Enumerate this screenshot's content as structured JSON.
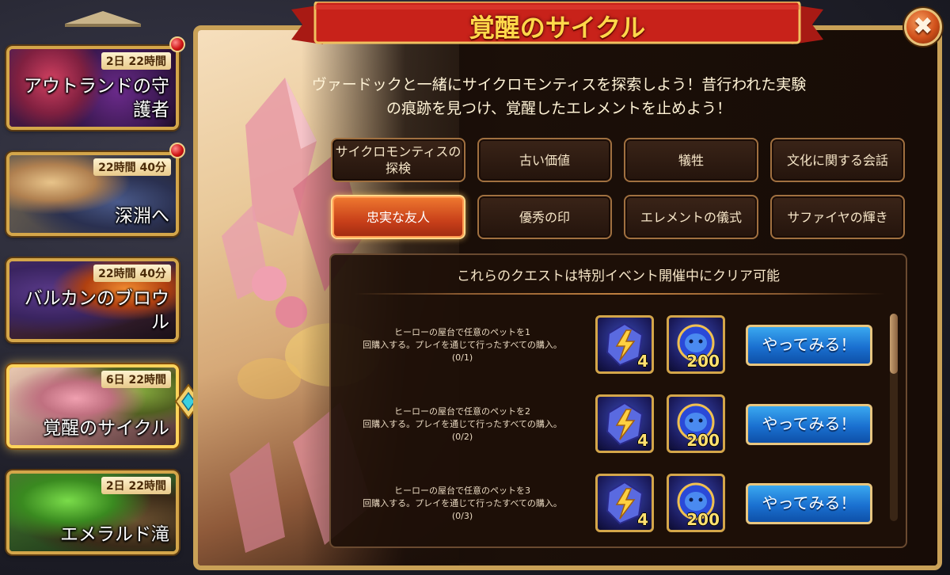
{
  "event_list": [
    {
      "title": "アウトランドの守護者",
      "timer": "2日 22時間",
      "notification": true,
      "active": false
    },
    {
      "title": "深淵へ",
      "timer": "22時間 40分",
      "notification": true,
      "active": false
    },
    {
      "title": "バルカンのブロウル",
      "timer": "22時間 40分",
      "notification": false,
      "active": false
    },
    {
      "title": "覚醒のサイクル",
      "timer": "6日 22時間",
      "notification": false,
      "active": true
    },
    {
      "title": "エメラルド滝",
      "timer": "2日 22時間",
      "notification": false,
      "active": false
    }
  ],
  "panel": {
    "title": "覚醒のサイクル",
    "close_icon": "✖",
    "description": "ヴァードックと一緒にサイクロモンティスを探索しよう！昔行われた実験の痕跡を見つけ、覚醒したエレメントを止めよう！"
  },
  "tabs": [
    {
      "label": "サイクロモンティスの探検",
      "active": false
    },
    {
      "label": "古い価値",
      "active": false
    },
    {
      "label": "犠牲",
      "active": false
    },
    {
      "label": "文化に関する会話",
      "active": false
    },
    {
      "label": "忠実な友人",
      "active": true
    },
    {
      "label": "優秀の印",
      "active": false
    },
    {
      "label": "エレメントの儀式",
      "active": false
    },
    {
      "label": "サファイヤの輝き",
      "active": false
    }
  ],
  "quests": {
    "header": "これらのクエストは特別イベント開催中にクリア可能",
    "items": [
      {
        "line1": "ヒーローの屋台で任意のペットを1",
        "line2": "回購入する。プレイを通じて行ったすべての購入。",
        "progress": "(0/1)",
        "reward1_qty": "4",
        "reward2_qty": "200",
        "button": "やってみる！"
      },
      {
        "line1": "ヒーローの屋台で任意のペットを2",
        "line2": "回購入する。プレイを通じて行ったすべての購入。",
        "progress": "(0/2)",
        "reward1_qty": "4",
        "reward2_qty": "200",
        "button": "やってみる！"
      },
      {
        "line1": "ヒーローの屋台で任意のペットを3",
        "line2": "回購入する。プレイを通じて行ったすべての購入。",
        "progress": "(0/3)",
        "reward1_qty": "4",
        "reward2_qty": "200",
        "button": "やってみる！"
      }
    ],
    "scroll_position": 0
  },
  "icons": {
    "reward1": "lightning-crystal-icon",
    "reward2": "pet-egg-icon"
  }
}
